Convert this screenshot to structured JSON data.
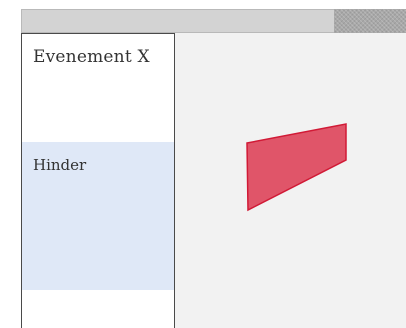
{
  "sidebar": {
    "title": "Evenement X",
    "section_label": "Hinder"
  },
  "canvas": {
    "shape": {
      "fill": "#e05569",
      "stroke": "#d11a36"
    }
  }
}
